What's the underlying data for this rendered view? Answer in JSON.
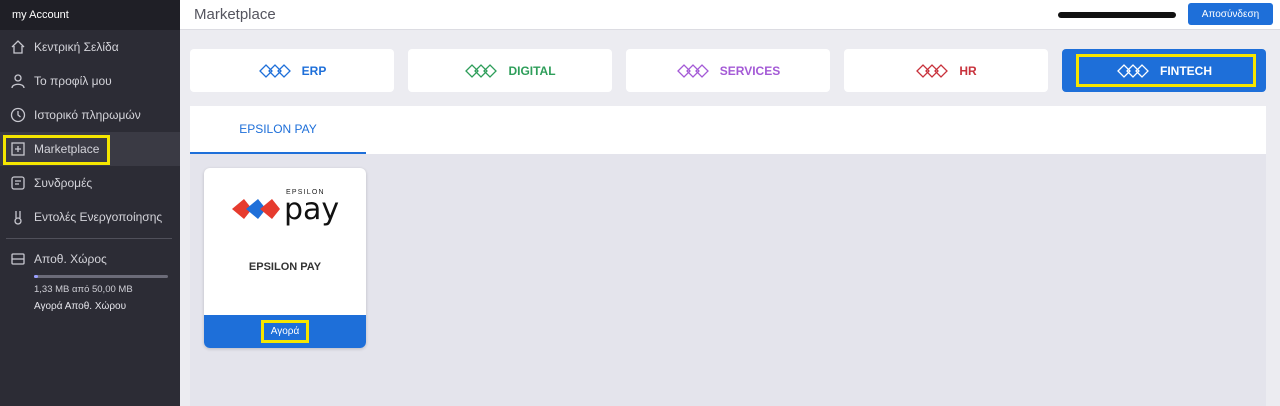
{
  "sidebar": {
    "header": "my Account",
    "items": [
      {
        "label": "Κεντρική Σελίδα",
        "icon": "home-icon"
      },
      {
        "label": "Το προφίλ μου",
        "icon": "user-icon"
      },
      {
        "label": "Ιστορικό πληρωμών",
        "icon": "history-icon"
      },
      {
        "label": "Marketplace",
        "icon": "marketplace-icon"
      },
      {
        "label": "Συνδρομές",
        "icon": "subscriptions-icon"
      },
      {
        "label": "Εντολές Ενεργοποίησης",
        "icon": "activation-icon"
      }
    ],
    "storage": {
      "title": "Αποθ. Χώρος",
      "usage": "1,33 MB από 50,00 MB",
      "used_fraction": 0.027,
      "buy": "Αγορά Αποθ. Χώρου"
    }
  },
  "topbar": {
    "title": "Marketplace",
    "logout": "Αποσύνδεση"
  },
  "categories": [
    {
      "label": "ERP",
      "color": "#1e6fd9"
    },
    {
      "label": "DIGITAL",
      "color": "#2e9e5a"
    },
    {
      "label": "SERVICES",
      "color": "#a45ad6"
    },
    {
      "label": "HR",
      "color": "#c8323c"
    },
    {
      "label": "FINTECH",
      "color": "#ffffff",
      "active": true
    }
  ],
  "tabs": [
    {
      "label": "EPSILON PAY"
    }
  ],
  "product": {
    "logo_small": "EPSILON",
    "logo_big": "pay",
    "name": "EPSILON PAY",
    "buy": "Αγορά"
  },
  "colors": {
    "accent": "#1e6fd9",
    "highlight": "#f5e600",
    "sidebar": "#2c2c35"
  }
}
